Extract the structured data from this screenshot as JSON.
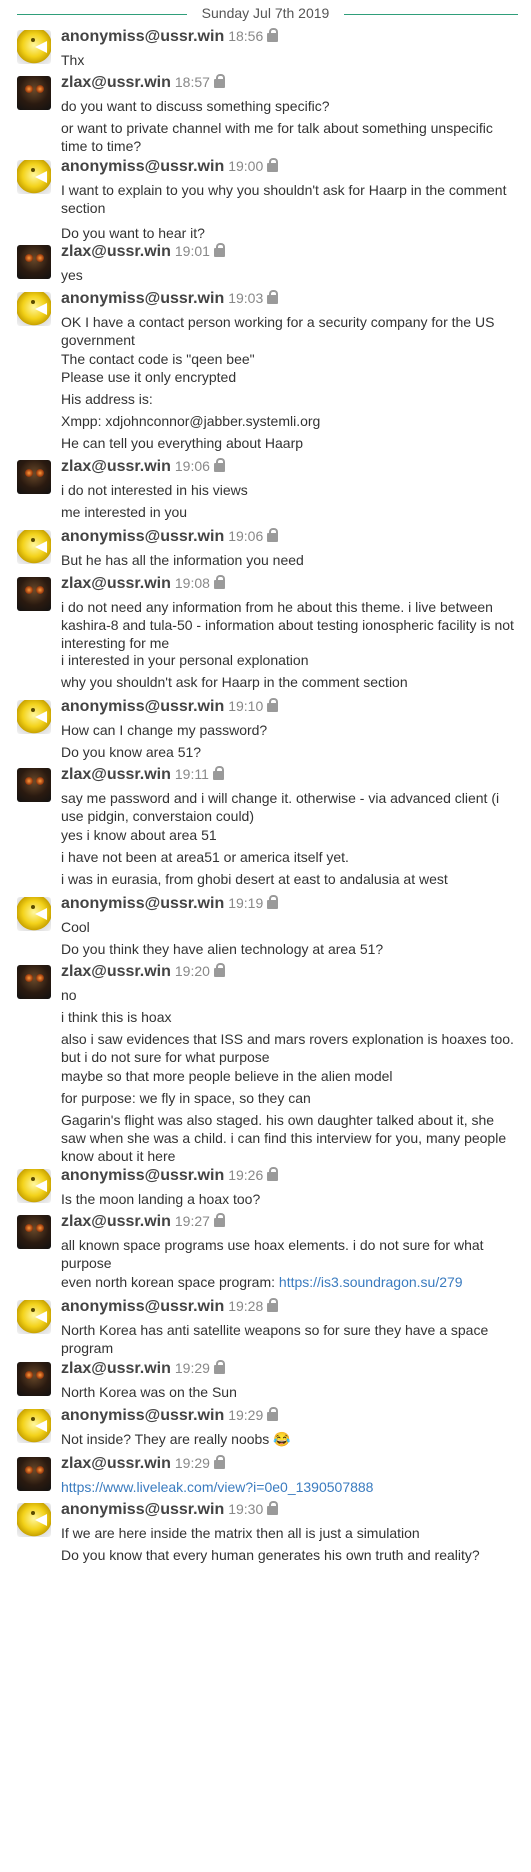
{
  "date_separator": "Sunday Jul 7th 2019",
  "messages": [
    {
      "avatar": "cheese",
      "nick": "anonymiss@ussr.win",
      "time": "18:56",
      "lines": [
        "Thx"
      ]
    },
    {
      "avatar": "mask",
      "nick": "zlax@ussr.win",
      "time": "18:57",
      "lines": [
        "do you want to discuss something specific?",
        "or want to private channel with me for talk about something unspecific time to time?"
      ]
    },
    {
      "avatar": "cheese",
      "nick": "anonymiss@ussr.win",
      "time": "19:00",
      "lines": [
        "I want to explain to you why you shouldn't ask for Haarp in the comment section",
        "Do you want to hear it?"
      ]
    },
    {
      "avatar": "mask",
      "nick": "zlax@ussr.win",
      "time": "19:01",
      "lines": [
        "yes"
      ]
    },
    {
      "avatar": "cheese",
      "nick": "anonymiss@ussr.win",
      "time": "19:03",
      "lines": [
        "OK I have a contact person working for a security company for the US government",
        "The contact code is \"qeen bee\"",
        "Please use it only encrypted",
        "His address is:",
        "Xmpp: xdjohnconnor@jabber.systemli.org",
        "He can tell you everything about Haarp"
      ]
    },
    {
      "avatar": "mask",
      "nick": "zlax@ussr.win",
      "time": "19:06",
      "lines": [
        "i do not interested in his views",
        "me interested in you"
      ]
    },
    {
      "avatar": "cheese",
      "nick": "anonymiss@ussr.win",
      "time": "19:06",
      "lines": [
        "But he has all the information you need"
      ]
    },
    {
      "avatar": "mask",
      "nick": "zlax@ussr.win",
      "time": "19:08",
      "lines": [
        "i do not need any information from he about this theme. i live between kashira-8 and tula-50 - information about testing ionospheric facility is not interesting for me",
        "i interested in your personal explonation",
        "why you shouldn't ask for Haarp in the comment section"
      ]
    },
    {
      "avatar": "cheese",
      "nick": "anonymiss@ussr.win",
      "time": "19:10",
      "lines": [
        "How can I change my password?",
        "Do you know area 51?"
      ]
    },
    {
      "avatar": "mask",
      "nick": "zlax@ussr.win",
      "time": "19:11",
      "lines": [
        "say me password and i will change it. otherwise - via advanced client (i use pidgin, converstaion could)",
        "yes i know about area 51",
        "i have not been at area51 or america itself yet.",
        "i was in eurasia, from ghobi desert at east to andalusia at west"
      ]
    },
    {
      "avatar": "cheese",
      "nick": "anonymiss@ussr.win",
      "time": "19:19",
      "lines": [
        "Cool",
        "Do you think they have alien technology at area 51?"
      ]
    },
    {
      "avatar": "mask",
      "nick": "zlax@ussr.win",
      "time": "19:20",
      "lines": [
        "no",
        "i think this is hoax",
        "also i saw evidences that ISS and mars rovers explonation is hoaxes too. but i do not sure for what purpose",
        "maybe so that more people believe in the alien model",
        "for purpose: we fly in space, so they can",
        "Gagarin's flight was also staged. his own daughter talked about it, she saw when she was a child. i can find this interview for you, many people know about it here"
      ]
    },
    {
      "avatar": "cheese",
      "nick": "anonymiss@ussr.win",
      "time": "19:26",
      "lines": [
        "Is the moon landing a hoax too?"
      ]
    },
    {
      "avatar": "mask",
      "nick": "zlax@ussr.win",
      "time": "19:27",
      "lines": [
        "all known space programs use hoax elements. i do not sure for what purpose",
        "even north korean space program: "
      ],
      "link": "https://is3.soundragon.su/279"
    },
    {
      "avatar": "cheese",
      "nick": "anonymiss@ussr.win",
      "time": "19:28",
      "lines": [
        "North Korea has anti satellite weapons so for sure they have a space program"
      ]
    },
    {
      "avatar": "mask",
      "nick": "zlax@ussr.win",
      "time": "19:29",
      "lines": [
        "North Korea was on the Sun"
      ]
    },
    {
      "avatar": "cheese",
      "nick": "anonymiss@ussr.win",
      "time": "19:29",
      "lines": [
        "Not inside? They are really noobs 😂"
      ]
    },
    {
      "avatar": "mask",
      "nick": "zlax@ussr.win",
      "time": "19:29",
      "lines": [],
      "link": "https://www.liveleak.com/view?i=0e0_1390507888"
    },
    {
      "avatar": "cheese",
      "nick": "anonymiss@ussr.win",
      "time": "19:30",
      "lines": [
        "If we are here inside the matrix then all is just a simulation",
        "Do you know that every human generates his own truth and reality?"
      ]
    }
  ]
}
